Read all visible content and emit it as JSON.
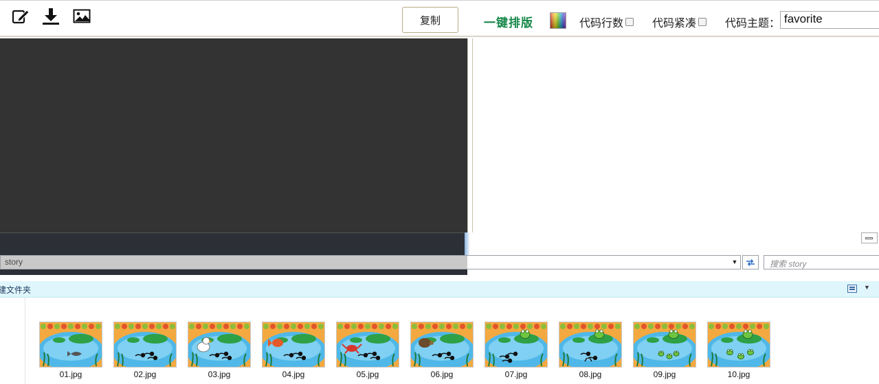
{
  "toolbar": {
    "copy_label": "复制",
    "format_label": "一键排版",
    "line_numbers_label": "代码行数",
    "compact_label": "代码紧凑",
    "theme_label": "代码主题：",
    "theme_value": "favorite"
  },
  "explorer": {
    "address": "story",
    "search_placeholder": "搜索 story",
    "new_folder_label": "建文件夹",
    "files": [
      {
        "name": "01.jpg",
        "scene": "fish"
      },
      {
        "name": "02.jpg",
        "scene": "tadpoles"
      },
      {
        "name": "03.jpg",
        "scene": "duck"
      },
      {
        "name": "04.jpg",
        "scene": "goldfish"
      },
      {
        "name": "05.jpg",
        "scene": "crab"
      },
      {
        "name": "06.jpg",
        "scene": "turtle"
      },
      {
        "name": "07.jpg",
        "scene": "frog-tadpoles"
      },
      {
        "name": "08.jpg",
        "scene": "frog-legs"
      },
      {
        "name": "09.jpg",
        "scene": "frog-froglets"
      },
      {
        "name": "10.jpg",
        "scene": "frog-family"
      }
    ]
  },
  "colors": {
    "format_green": "#17884a",
    "editor_dark": "#333333",
    "cmd_bar": "#dff6fc"
  }
}
